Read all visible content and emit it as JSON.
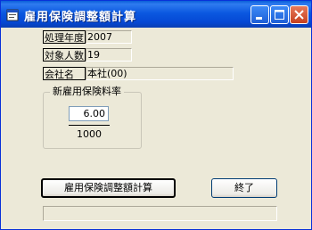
{
  "window": {
    "title": "雇用保険調整額計算"
  },
  "fields": [
    {
      "label": "処理年度",
      "value": "2007"
    },
    {
      "label": "対象人数",
      "value": "19"
    },
    {
      "label": "会社名",
      "value": "本社(00)"
    }
  ],
  "rate_group": {
    "title": "新雇用保険料率",
    "numerator": "6.00",
    "denominator": "1000"
  },
  "buttons": {
    "calculate": "雇用保険調整額計算",
    "exit": "終了"
  },
  "status_text": ""
}
